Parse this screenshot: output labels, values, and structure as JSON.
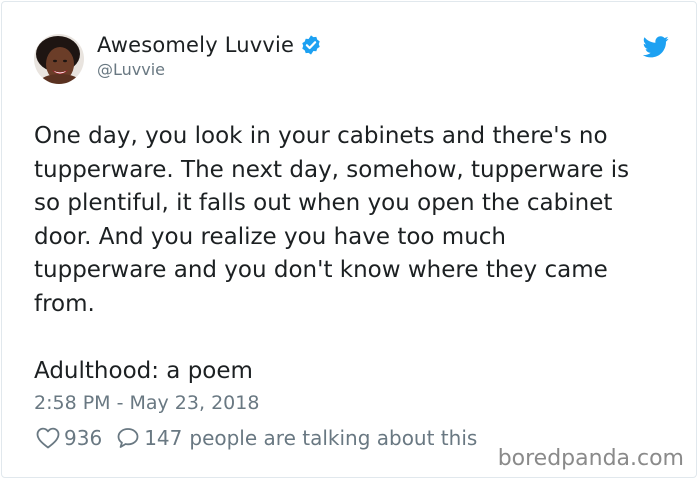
{
  "author": {
    "display_name": "Awesomely Luvvie",
    "handle": "@Luvvie",
    "avatar_icon": "avatar-portrait",
    "verified_icon": "verified-badge-icon"
  },
  "tweet": {
    "body": "One day, you look in your cabinets and there's no\ntupperware. The next day, somehow, tupperware is\nso plentiful, it falls out when you open the cabinet\ndoor. And you realize you have too much\ntupperware and you don't know where they came\nfrom.\n\nAdulthood: a poem",
    "timestamp": "2:58 PM - May 23, 2018"
  },
  "stats": {
    "likes": "936",
    "replies": "147",
    "talking_label": "people are talking about this"
  },
  "watermark": "boredpanda.com",
  "colors": {
    "accent": "#1da1f2",
    "text": "#1c2022",
    "muted": "#697882",
    "border": "#e1e8ed"
  }
}
